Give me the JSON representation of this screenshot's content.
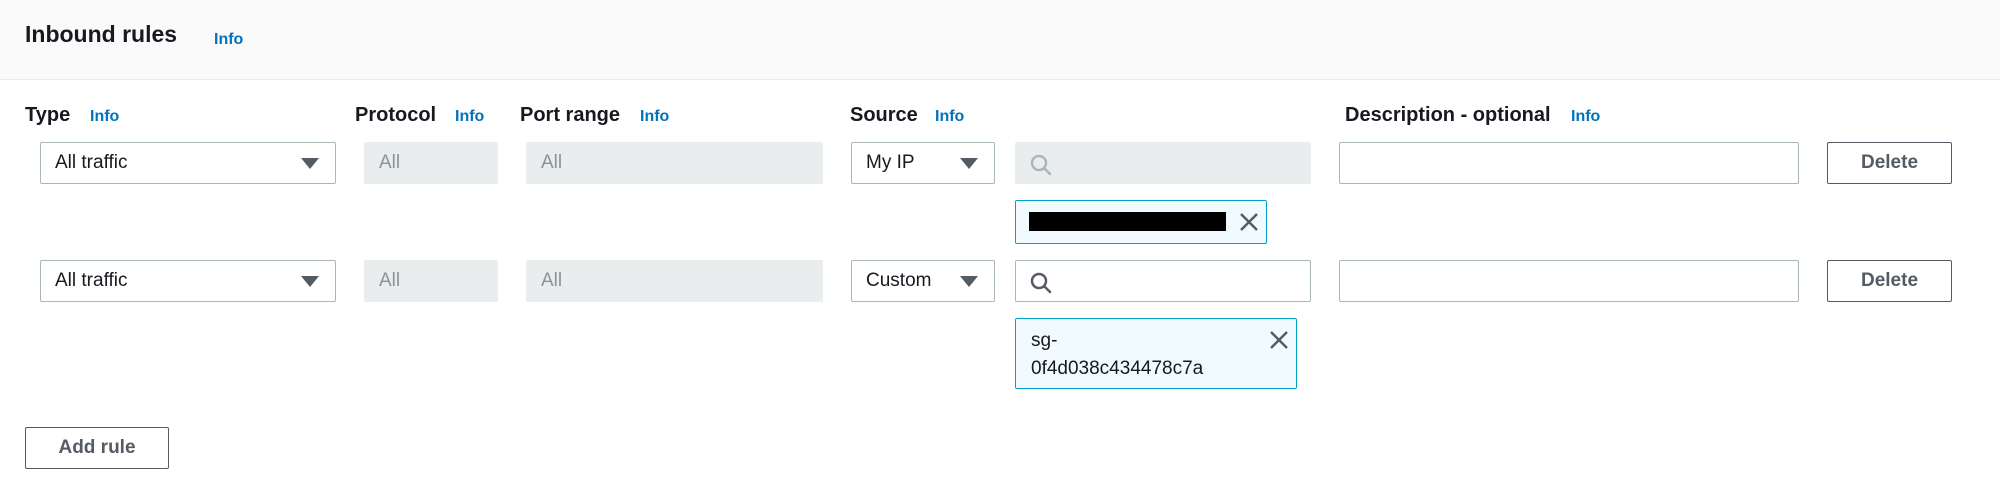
{
  "header": {
    "title": "Inbound rules",
    "info": "Info"
  },
  "columns": {
    "type": {
      "label": "Type",
      "info": "Info"
    },
    "protocol": {
      "label": "Protocol",
      "info": "Info"
    },
    "port_range": {
      "label": "Port range",
      "info": "Info"
    },
    "source": {
      "label": "Source",
      "info": "Info"
    },
    "description": {
      "label": "Description - optional",
      "info": "Info"
    }
  },
  "rules": [
    {
      "type": "All traffic",
      "protocol": "All",
      "port_range": "All",
      "source": "My IP",
      "search_value": "",
      "token": {
        "redacted": true,
        "line1": "",
        "line2": ""
      },
      "description": "",
      "delete_label": "Delete"
    },
    {
      "type": "All traffic",
      "protocol": "All",
      "port_range": "All",
      "source": "Custom",
      "search_value": "",
      "token": {
        "redacted": false,
        "line1": "sg-",
        "line2": "0f4d038c434478c7a"
      },
      "description": "",
      "delete_label": "Delete"
    }
  ],
  "add_rule_label": "Add rule",
  "colors": {
    "link": "#0073bb",
    "token_border": "#00a1c9",
    "token_bg": "#f1faff",
    "disabled_bg": "#eaeded"
  },
  "icons": {
    "search": "search-icon",
    "caret": "caret-down-icon",
    "remove": "close-icon"
  }
}
